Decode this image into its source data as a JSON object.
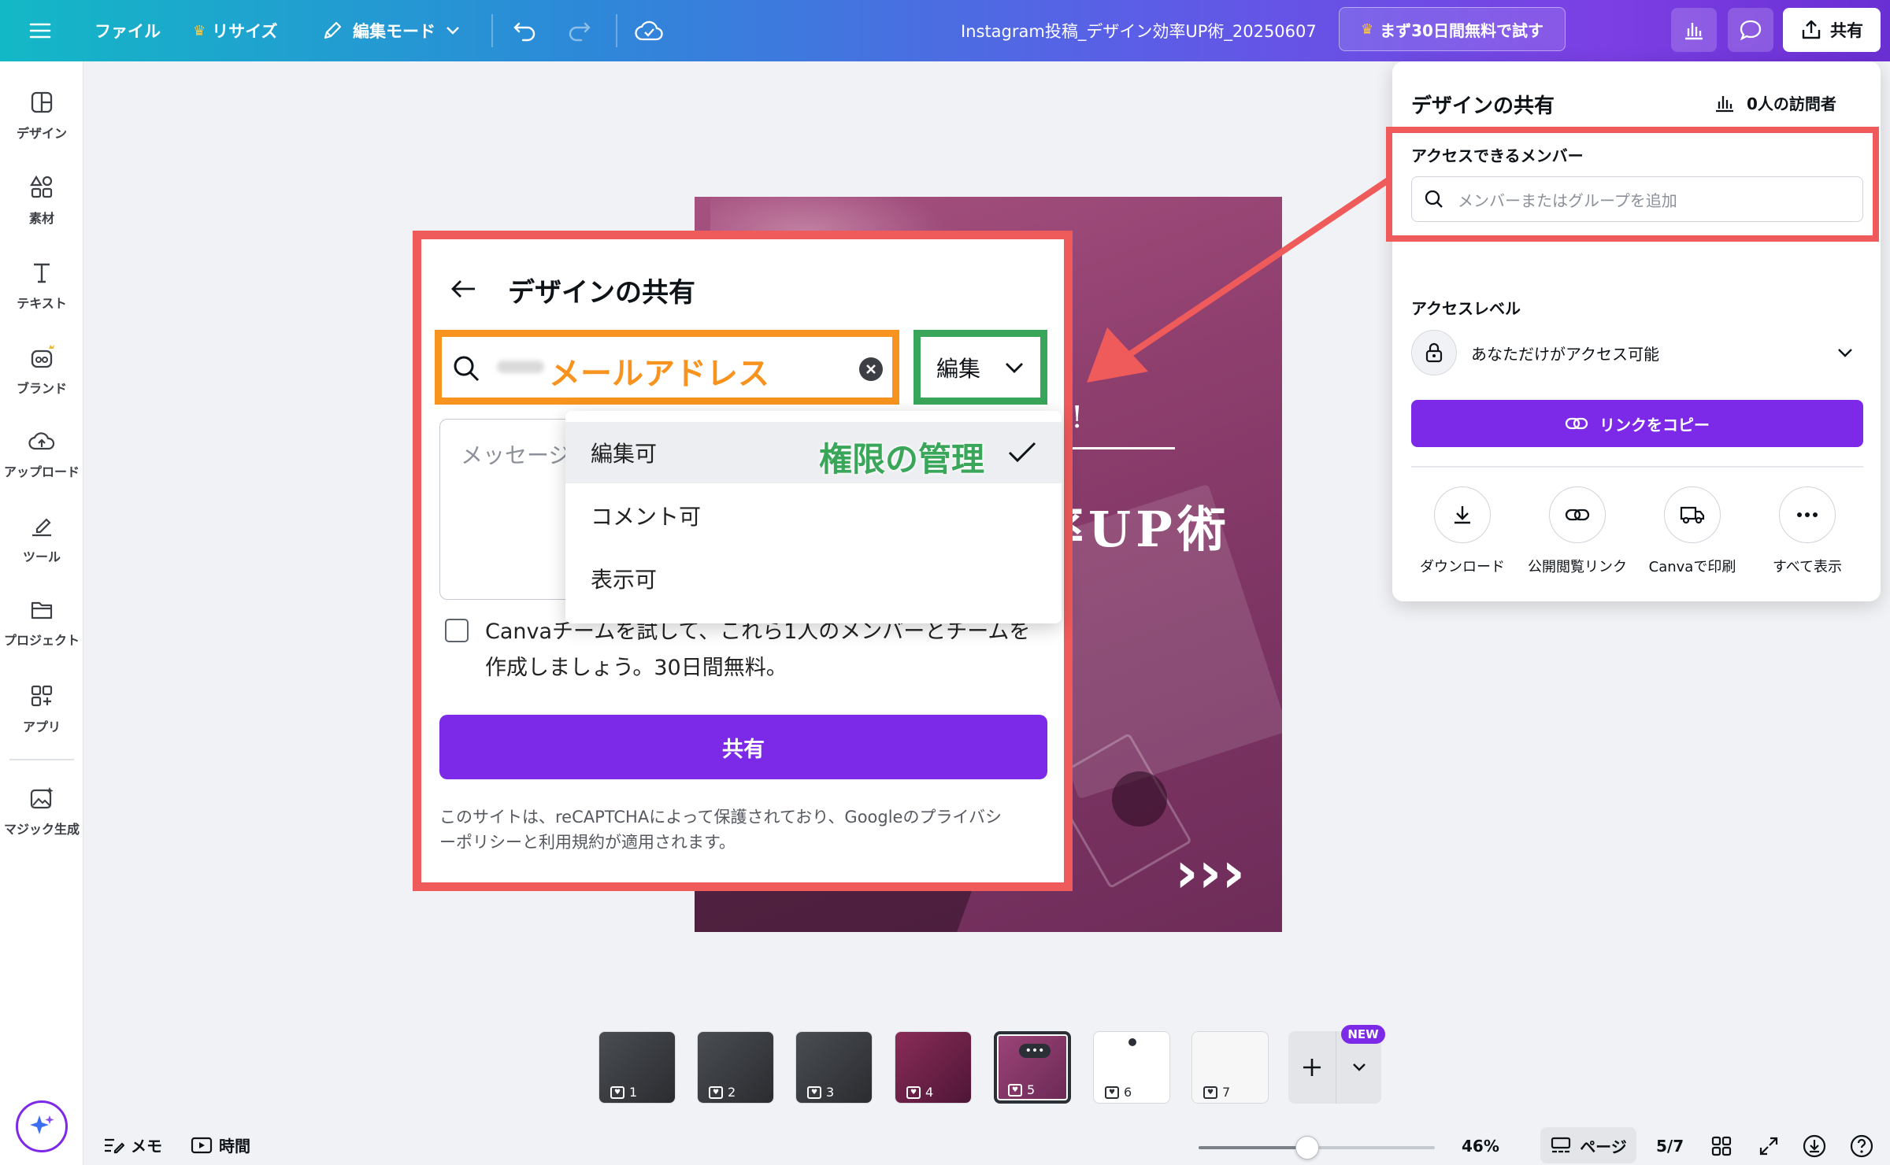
{
  "topbar": {
    "file": "ファイル",
    "resize": "リサイズ",
    "edit_mode": "編集モード",
    "doc_title": "Instagram投稿_デザイン効率UP術_20250607",
    "trial": "まず30日間無料で試す",
    "share": "共有"
  },
  "sidebar": {
    "items": [
      {
        "label": "デザイン",
        "icon": "layout-icon"
      },
      {
        "label": "素材",
        "icon": "elements-icon"
      },
      {
        "label": "テキスト",
        "icon": "text-icon"
      },
      {
        "label": "ブランド",
        "icon": "brand-icon"
      },
      {
        "label": "アップロード",
        "icon": "upload-cloud-icon"
      },
      {
        "label": "ツール",
        "icon": "draw-tool-icon"
      },
      {
        "label": "プロジェクト",
        "icon": "folder-icon"
      },
      {
        "label": "アプリ",
        "icon": "apps-icon"
      },
      {
        "label": "マジック生成",
        "icon": "magic-image-icon"
      }
    ]
  },
  "design": {
    "title_frag": "率UP術",
    "exclaim": "!",
    "arrows": "›››"
  },
  "share_panel": {
    "title": "デザインの共有",
    "visitors": "0人の訪問者",
    "members_label": "アクセスできるメンバー",
    "members_placeholder": "メンバーまたはグループを追加",
    "access_level_label": "アクセスレベル",
    "access_value": "あなただけがアクセス可能",
    "copy_link": "リンクをコピー",
    "actions": [
      {
        "label": "ダウンロード",
        "icon": "download-icon"
      },
      {
        "label": "公開閲覧リンク",
        "icon": "link-icon"
      },
      {
        "label": "Canvaで印刷",
        "icon": "truck-icon"
      },
      {
        "label": "すべて表示",
        "icon": "more-icon"
      }
    ]
  },
  "dialog": {
    "title": "デザインの共有",
    "email_annotation": "メールアドレス",
    "permission_value": "編集",
    "message_placeholder": "メッセージ",
    "checkbox_text_line1": "Canvaチームを試して、これら1人のメンバーとチームを",
    "checkbox_text_line2": "作成しましょう。30日間無料。",
    "share_button": "共有",
    "recaptcha_line1": "このサイトは、reCAPTCHAによって保護されており、Googleのプライバシ",
    "recaptcha_line2": "ーポリシーと利用規約が適用されます。"
  },
  "permission_menu": {
    "annotation": "権限の管理",
    "options": [
      "編集可",
      "コメント可",
      "表示可"
    ],
    "selected": "編集可"
  },
  "pages": {
    "thumbs": [
      "1",
      "2",
      "3",
      "4",
      "5",
      "6",
      "7"
    ],
    "current": "5",
    "new_badge": "NEW"
  },
  "bottombar": {
    "notes": "メモ",
    "timer": "時間",
    "zoom": "46%",
    "zoom_fraction": 0.46,
    "page_view": "ページ",
    "page_counter": "5/7"
  },
  "colors": {
    "accent": "#7d2ae8",
    "highlight_red": "#ef5a5a",
    "annotation_orange": "#f7931e",
    "annotation_green": "#3aa65a"
  }
}
